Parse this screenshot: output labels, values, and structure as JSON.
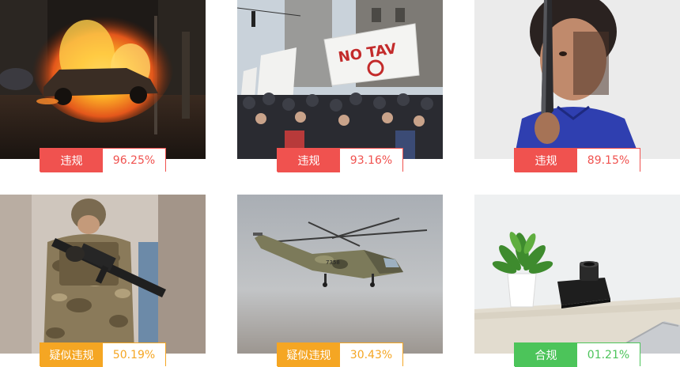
{
  "results": [
    {
      "label": "违规",
      "percent": "96.25%",
      "status": "violation",
      "color": "#f0524f",
      "image": "car-fire-riot-photo"
    },
    {
      "label": "违规",
      "percent": "93.16%",
      "status": "violation",
      "color": "#f0524f",
      "image": "protest-crowd-photo"
    },
    {
      "label": "违规",
      "percent": "89.15%",
      "status": "violation",
      "color": "#f0524f",
      "image": "woman-holding-knife-photo"
    },
    {
      "label": "疑似违规",
      "percent": "50.19%",
      "status": "suspected",
      "color": "#f5a623",
      "image": "armed-soldier-photo"
    },
    {
      "label": "疑似违规",
      "percent": "30.43%",
      "status": "suspected",
      "color": "#f5a623",
      "image": "military-helicopter-photo"
    },
    {
      "label": "合规",
      "percent": "01.21%",
      "status": "compliant",
      "color": "#4cc45a",
      "image": "desk-plant-camera-photo"
    }
  ]
}
